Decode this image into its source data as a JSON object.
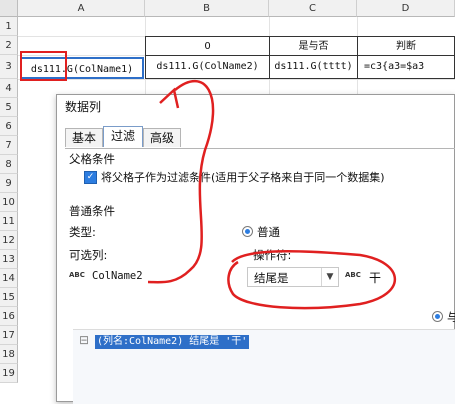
{
  "sheet": {
    "columns": [
      "A",
      "B",
      "C",
      "D"
    ],
    "rows": [
      "1",
      "2",
      "3",
      "4",
      "5",
      "6",
      "7",
      "8",
      "9",
      "10",
      "11",
      "12",
      "13",
      "14",
      "15",
      "16",
      "17",
      "18",
      "19"
    ],
    "row2": {
      "b": "0",
      "c": "是与否",
      "d": "判断"
    },
    "row3": {
      "a": "ds111.G(ColName1)",
      "b": "ds111.G(ColName2)",
      "c": "ds111.G(tttt)",
      "d": "=c3{a3=$a3"
    }
  },
  "dialog": {
    "title": "数据列",
    "tabs": [
      "基本",
      "过滤",
      "高级"
    ],
    "active_tab": "过滤",
    "parent_section": {
      "title": "父格条件",
      "checkbox_label": "将父格子作为过滤条件(适用于父子格来自于同一个数据集)",
      "checked": true
    },
    "common_section": {
      "title": "普通条件",
      "type_label": "类型:",
      "type_option": "普通",
      "available_label": "可选列:",
      "available_value": "ColName2",
      "operator_label": "操作符:",
      "operator_value": "结尾是",
      "value_text": "干",
      "right_radio_label": "与"
    },
    "expression": "(列名:ColName2) 结尾是 '干'"
  },
  "icons": {
    "check": "check-icon",
    "dropdown": "chevron-down-icon",
    "abc": "abc-type-icon"
  },
  "colors": {
    "accent": "#2d7de0",
    "annotation": "#e02020",
    "selection": "#2e6fc8"
  }
}
